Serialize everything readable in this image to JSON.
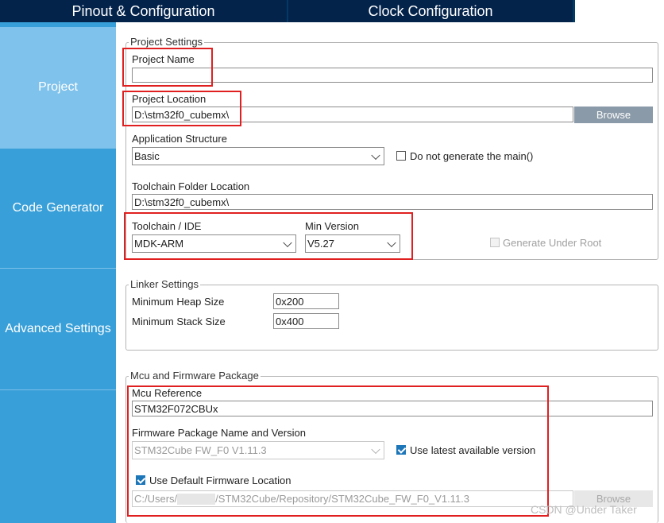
{
  "tabs": [
    {
      "label": "Pinout & Configuration"
    },
    {
      "label": "Clock Configuration"
    },
    {
      "label": ""
    }
  ],
  "sidebar": {
    "items": [
      {
        "label": "Project"
      },
      {
        "label": "Code Generator"
      },
      {
        "label": "Advanced Settings"
      }
    ]
  },
  "project_settings": {
    "legend": "Project Settings",
    "project_name_label": "Project Name",
    "project_name_value": "",
    "project_location_label": "Project Location",
    "project_location_value": "D:\\stm32f0_cubemx\\",
    "browse_label": "Browse",
    "app_structure_label": "Application Structure",
    "app_structure_value": "Basic",
    "no_main_label": "Do not generate the main()",
    "toolchain_folder_label": "Toolchain Folder Location",
    "toolchain_folder_value": "D:\\stm32f0_cubemx\\",
    "toolchain_label": "Toolchain / IDE",
    "toolchain_value": "MDK-ARM",
    "min_version_label": "Min Version",
    "min_version_value": "V5.27",
    "generate_under_root_label": "Generate Under Root"
  },
  "linker_settings": {
    "legend": "Linker Settings",
    "heap_label": "Minimum Heap Size",
    "heap_value": "0x200",
    "stack_label": "Minimum Stack Size",
    "stack_value": "0x400"
  },
  "mcu_firmware": {
    "legend": "Mcu and Firmware Package",
    "mcu_ref_label": "Mcu Reference",
    "mcu_ref_value": "STM32F072CBUx",
    "fw_pkg_label": "Firmware Package Name and Version",
    "fw_pkg_value": "STM32Cube FW_F0 V1.11.3",
    "use_latest_label": "Use latest available version",
    "use_default_loc_label": "Use Default Firmware Location",
    "fw_path_prefix": "C:/Users/",
    "fw_path_suffix": "/STM32Cube/Repository/STM32Cube_FW_F0_V1.11.3",
    "browse_label": "Browse"
  },
  "watermark": "CSDN @Under Taker",
  "colors": {
    "tab_bg": "#03234b",
    "sidebar_bg": "#389fd8",
    "sidebar_active": "#7fc2eb",
    "highlight": "#e02020",
    "checkbox": "#1d76b8"
  }
}
